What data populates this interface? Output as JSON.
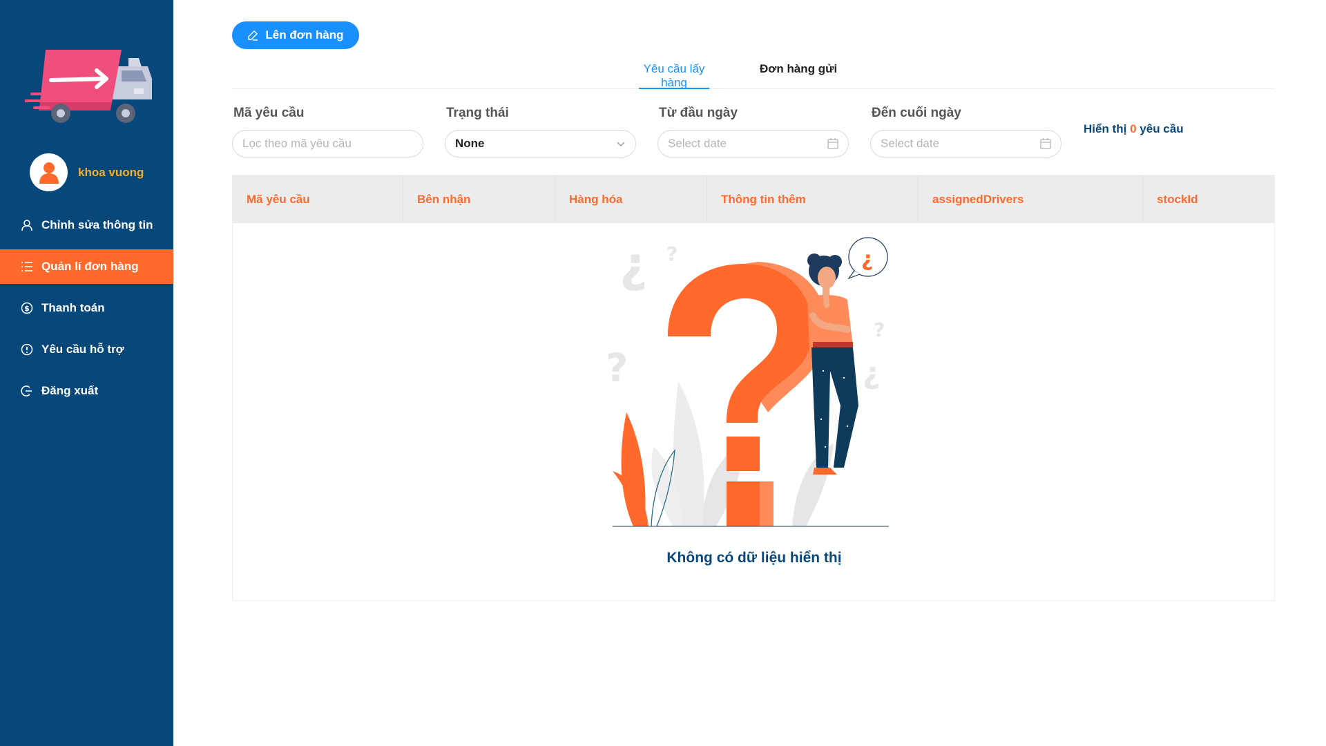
{
  "sidebar": {
    "user": {
      "name": "khoa vuong"
    },
    "menu": [
      {
        "label": "Chỉnh sửa thông tin",
        "icon": "user-icon"
      },
      {
        "label": "Quản lí đơn hàng",
        "icon": "list-icon",
        "active": true
      },
      {
        "label": "Thanh toán",
        "icon": "dollar-icon"
      },
      {
        "label": "Yêu cầu hỗ trợ",
        "icon": "alert-icon"
      },
      {
        "label": "Đăng xuất",
        "icon": "logout-icon"
      }
    ],
    "colors": {
      "background": "#08477a",
      "active": "#ff6a2c",
      "username": "#f6b02c"
    }
  },
  "toolbar": {
    "create_label": "Lên đơn hàng"
  },
  "tabs": [
    {
      "label": "Yêu cầu lấy hàng",
      "active": true
    },
    {
      "label": "Đơn hàng gửi",
      "active": false
    }
  ],
  "filters": {
    "request_code": {
      "label": "Mã yêu cầu",
      "placeholder": "Lọc theo mã yêu cầu"
    },
    "status": {
      "label": "Trạng thái",
      "value": "None"
    },
    "from_date": {
      "label": "Từ đầu ngày",
      "placeholder": "Select date"
    },
    "to_date": {
      "label": "Đến cuối ngày",
      "placeholder": "Select date"
    }
  },
  "summary": {
    "prefix": "Hiển thị",
    "count": "0",
    "suffix": "yêu cầu"
  },
  "table": {
    "columns": [
      "Mã yêu cầu",
      "Bên nhận",
      "Hàng hóa",
      "Thông tin thêm",
      "assignedDrivers",
      "stockId"
    ],
    "rows": [],
    "empty_text": "Không có dữ liệu hiển thị"
  },
  "theme": {
    "primary": "#1890ff",
    "accent": "#ff6a2c",
    "navy": "#08477a"
  }
}
